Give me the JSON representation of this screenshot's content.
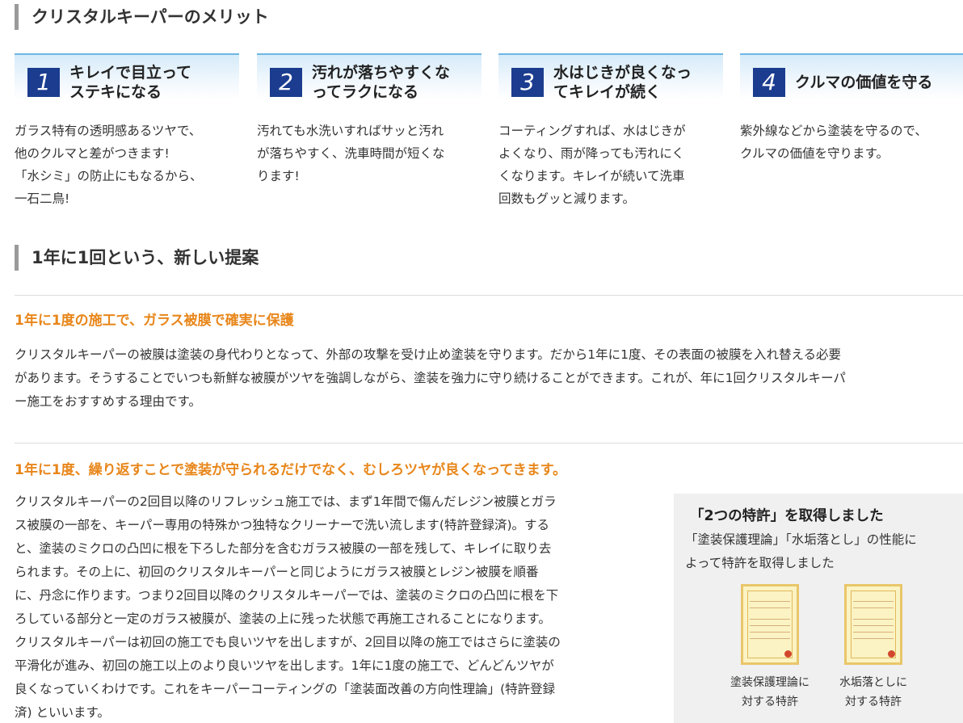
{
  "section1": {
    "title": "クリスタルキーパーのメリット"
  },
  "merits": [
    {
      "num": "1",
      "title_lines": [
        "キレイで目立って",
        "ステキになる"
      ],
      "body": [
        "ガラス特有の透明感あるツヤで、",
        "他のクルマと差がつきます!",
        "「水シミ」の防止にもなるから、",
        "一石二鳥!"
      ]
    },
    {
      "num": "2",
      "title_lines": [
        "汚れが落ちやすくな",
        "ってラクになる"
      ],
      "body": [
        "汚れても水洗いすればサッと汚れ",
        "が落ちやすく、洗車時間が短くな",
        "ります!"
      ]
    },
    {
      "num": "3",
      "title_lines": [
        "水はじきが良くなっ",
        "てキレイが続く"
      ],
      "body": [
        "コーティングすれば、水はじきが",
        "よくなり、雨が降っても汚れにく",
        "くなります。キレイが続いて洗車",
        "回数もグッと減ります。"
      ]
    },
    {
      "num": "4",
      "title_lines": [
        "クルマの価値を守る"
      ],
      "body": [
        "紫外線などから塗装を守るので、",
        "クルマの価値を守ります。"
      ]
    }
  ],
  "section2": {
    "title": "1年に1回という、新しい提案"
  },
  "block1": {
    "heading": "1年に1度の施工で、ガラス被膜で確実に保護",
    "lines": [
      "クリスタルキーパーの被膜は塗装の身代わりとなって、外部の攻撃を受け止め塗装を守ります。だから1年に1度、その表面の被膜を入れ替える必要",
      "があります。そうすることでいつも新鮮な被膜がツヤを強調しながら、塗装を強力に守り続けることができます。これが、年に1回クリスタルキーパ",
      "ー施工をおすすめする理由です。"
    ]
  },
  "block2": {
    "heading": "1年に1度、繰り返すことで塗装が守られるだけでなく、むしろツヤが良くなってきます。",
    "lines": [
      "クリスタルキーパーの2回目以降のリフレッシュ施工では、まず1年間で傷んだレジン被膜とガラ",
      "ス被膜の一部を、キーパー専用の特殊かつ独特なクリーナーで洗い流します(特許登録済)。する",
      "と、塗装のミクロの凸凹に根を下ろした部分を含むガラス被膜の一部を残して、キレイに取り去",
      "られます。その上に、初回のクリスタルキーパーと同じようにガラス被膜とレジン被膜を順番",
      "に、丹念に作ります。つまり2回目以降のクリスタルキーパーでは、塗装のミクロの凸凹に根を下",
      "ろしている部分と一定のガラス被膜が、塗装の上に残った状態で再施工されることになります。",
      "クリスタルキーパーは初回の施工でも良いツヤを出しますが、2回目以降の施工ではさらに塗装の",
      "平滑化が進み、初回の施工以上のより良いツヤを出します。1年に1度の施工で、どんどんツヤが",
      "良くなっていくわけです。これをキーパーコーティングの「塗装面改善の方向性理論」(特許登録",
      "済) といいます。"
    ]
  },
  "patent": {
    "title": "「2つの特許」を取得しました",
    "desc_lines": [
      "「塗装保護理論」「水垢落とし」の性能に",
      "よって特許を取得しました"
    ],
    "items": [
      {
        "caption_lines": [
          "塗装保護理論に",
          "対する特許"
        ],
        "icon": "certificate-icon"
      },
      {
        "caption_lines": [
          "水垢落としに",
          "対する特許"
        ],
        "icon": "certificate-icon"
      }
    ]
  },
  "colors": {
    "accent_orange": "#e8861a",
    "number_blue": "#1b3c8f",
    "header_line": "#6fb6e6"
  }
}
